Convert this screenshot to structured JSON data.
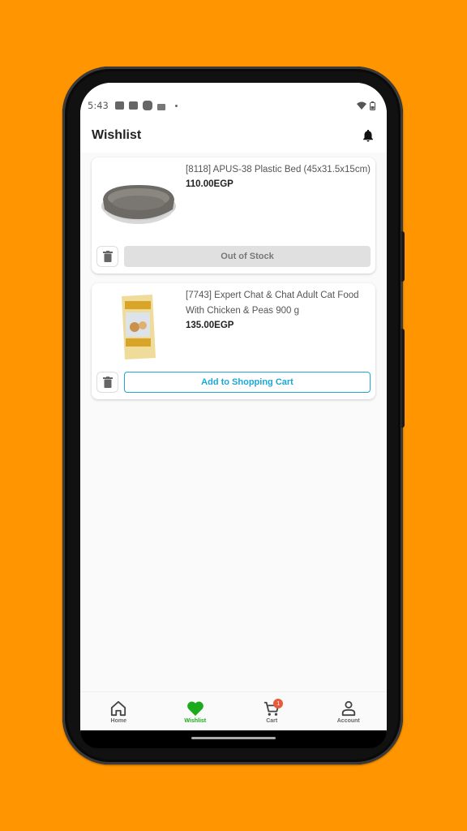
{
  "statusbar": {
    "time": "5:43",
    "icons": [
      "notification-icon",
      "notification-icon",
      "app-icon",
      "vpn-lock-icon",
      "dot-icon"
    ],
    "right_icons": [
      "wifi-icon",
      "battery-icon"
    ]
  },
  "appbar": {
    "title": "Wishlist",
    "action_icon": "bell-icon"
  },
  "wishlist": {
    "items": [
      {
        "name": "[8118] APUS-38 Plastic Bed (45x31.5x15cm)",
        "price": "110.00EGP",
        "image": "plastic-pet-bed",
        "action_label": "Out of Stock",
        "action_state": "disabled"
      },
      {
        "name": "[7743] Expert Chat & Chat Adult Cat Food With Chicken & Peas 900 g",
        "price": "135.00EGP",
        "image": "cat-food-bag",
        "action_label": "Add to Shopping Cart",
        "action_state": "enabled"
      }
    ]
  },
  "bottom_nav": {
    "items": [
      {
        "label": "Home",
        "icon": "home-icon",
        "active": false
      },
      {
        "label": "Wishlist",
        "icon": "heart-icon",
        "active": true
      },
      {
        "label": "Cart",
        "icon": "cart-icon",
        "active": false,
        "badge": "1"
      },
      {
        "label": "Account",
        "icon": "account-icon",
        "active": false
      }
    ]
  },
  "colors": {
    "background": "#FF9500",
    "accent_green": "#1aaa1a",
    "accent_blue": "#1ba8d4",
    "badge_red": "#e85a3a"
  }
}
